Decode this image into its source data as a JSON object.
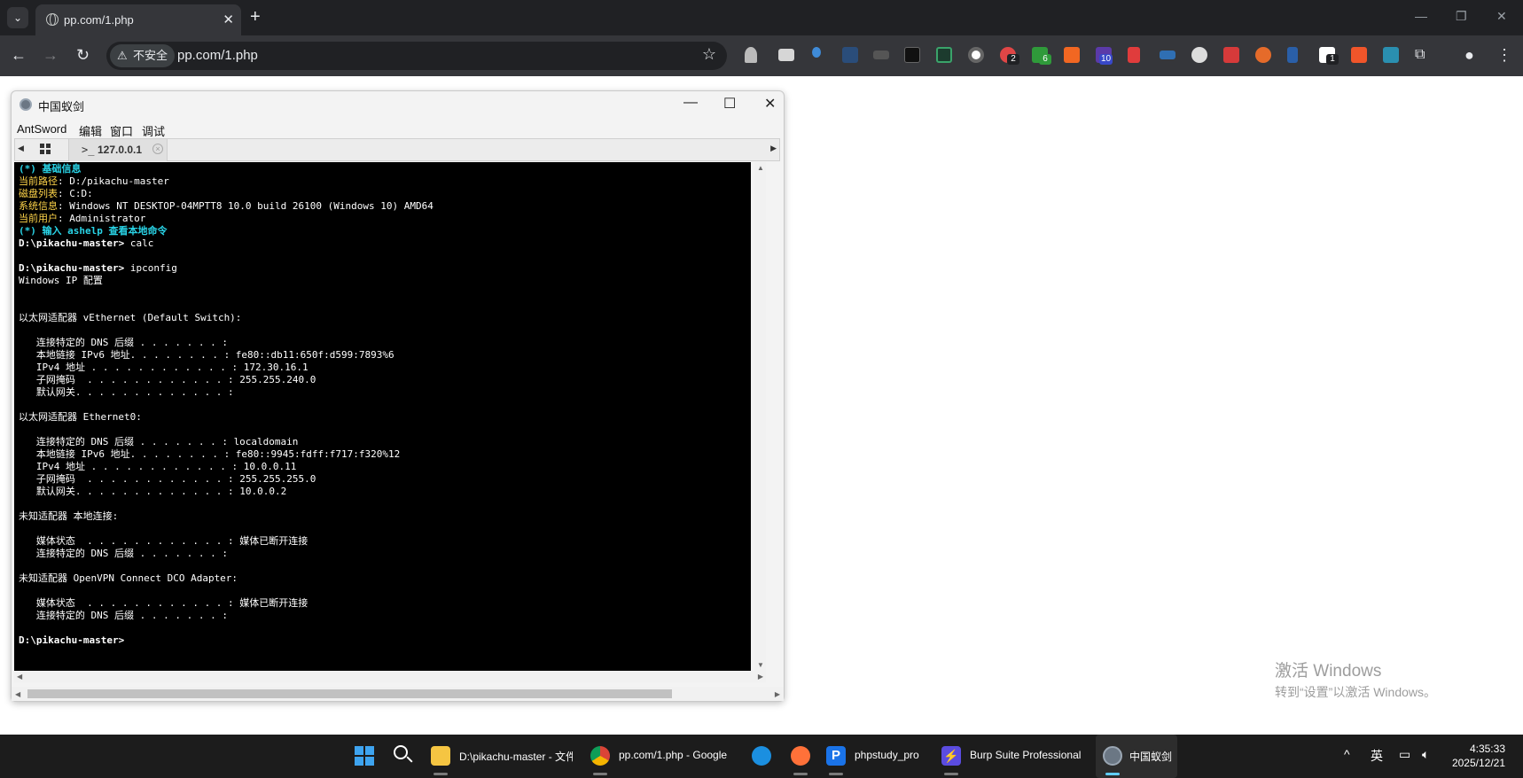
{
  "browser": {
    "tab_title": "pp.com/1.php",
    "security_label": "不安全",
    "url": "pp.com/1.php",
    "extension_badges": [
      "2",
      "6",
      "10",
      "1"
    ]
  },
  "app": {
    "window_title": "中国蚁剑",
    "menu": [
      "AntSword",
      "编辑",
      "窗口",
      "调试"
    ],
    "tab_label": "127.0.0.1",
    "tab_prompt_symbol": ">_"
  },
  "terminal": {
    "info_header": "(*) 基础信息",
    "info": [
      {
        "key": "当前路径",
        "value": "D:/pikachu-master"
      },
      {
        "key": "磁盘列表",
        "value": "C:D:"
      },
      {
        "key": "系统信息",
        "value": "Windows NT DESKTOP-04MPTT8 10.0 build 26100 (Windows 10) AMD64"
      },
      {
        "key": "当前用户",
        "value": "Administrator"
      }
    ],
    "help_hint": "(*) 输入 ashelp 查看本地命令",
    "prompt": "D:\\pikachu-master>",
    "cmd1": "calc",
    "cmd2": "ipconfig",
    "output": "Windows IP 配置\n\n\n以太网适配器 vEthernet (Default Switch):\n\n   连接特定的 DNS 后缀 . . . . . . . :\n   本地链接 IPv6 地址. . . . . . . . : fe80::db11:650f:d599:7893%6\n   IPv4 地址 . . . . . . . . . . . . : 172.30.16.1\n   子网掩码  . . . . . . . . . . . . : 255.255.240.0\n   默认网关. . . . . . . . . . . . . :\n\n以太网适配器 Ethernet0:\n\n   连接特定的 DNS 后缀 . . . . . . . : localdomain\n   本地链接 IPv6 地址. . . . . . . . : fe80::9945:fdff:f717:f320%12\n   IPv4 地址 . . . . . . . . . . . . : 10.0.0.11\n   子网掩码  . . . . . . . . . . . . : 255.255.255.0\n   默认网关. . . . . . . . . . . . . : 10.0.0.2\n\n未知适配器 本地连接:\n\n   媒体状态  . . . . . . . . . . . . : 媒体已断开连接\n   连接特定的 DNS 后缀 . . . . . . . :\n\n未知适配器 OpenVPN Connect DCO Adapter:\n\n   媒体状态  . . . . . . . . . . . . : 媒体已断开连接\n   连接特定的 DNS 后缀 . . . . . . . :\n"
  },
  "watermark": {
    "title": "激活 Windows",
    "subtitle": "转到“设置”以激活 Windows。"
  },
  "taskbar": {
    "explorer_label": "D:\\pikachu-master - 文件",
    "chrome_label": "pp.com/1.php - Google",
    "phpstudy_label": "phpstudy_pro",
    "burp_label": "Burp Suite Professional",
    "antsword_label": "中国蚁剑",
    "ime": "英",
    "time": "4:35:33",
    "date": "2025/12/21"
  },
  "colors": {
    "terminal_bg": "#000000",
    "terminal_cyan": "#29d3e6",
    "terminal_yellow": "#ffd54a",
    "taskbar_bg": "#1c1c1c"
  }
}
